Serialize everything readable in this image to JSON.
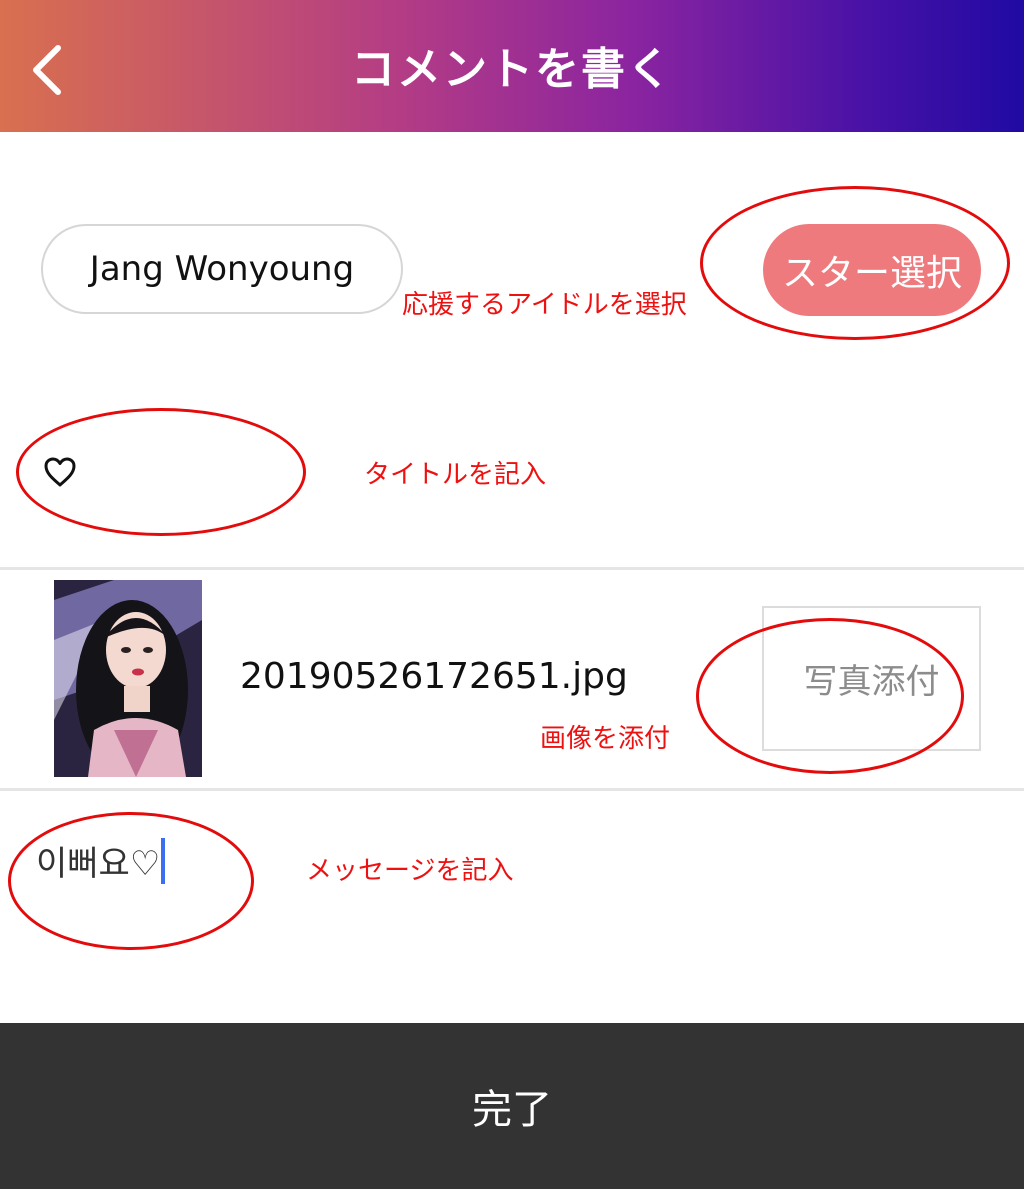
{
  "header": {
    "title": "コメントを書く",
    "back_icon": "chevron-left-icon"
  },
  "star": {
    "selected_name": "Jang Wonyoung",
    "select_button_label": "スター選択",
    "annotation": "応援するアイドルを選択"
  },
  "title_field": {
    "value": "♡",
    "annotation": "タイトルを記入"
  },
  "attachment": {
    "file_name": "20190526172651.jpg",
    "attach_button_label": "写真添付",
    "annotation": "画像を添付"
  },
  "message": {
    "value": "이뻐요♡",
    "annotation": "メッセージを記入"
  },
  "footer": {
    "done_label": "完了"
  },
  "colors": {
    "annotation": "#ee1111",
    "select_button": "#ef7a7d",
    "done_bar": "#333333",
    "cursor": "#3b6ff0"
  }
}
